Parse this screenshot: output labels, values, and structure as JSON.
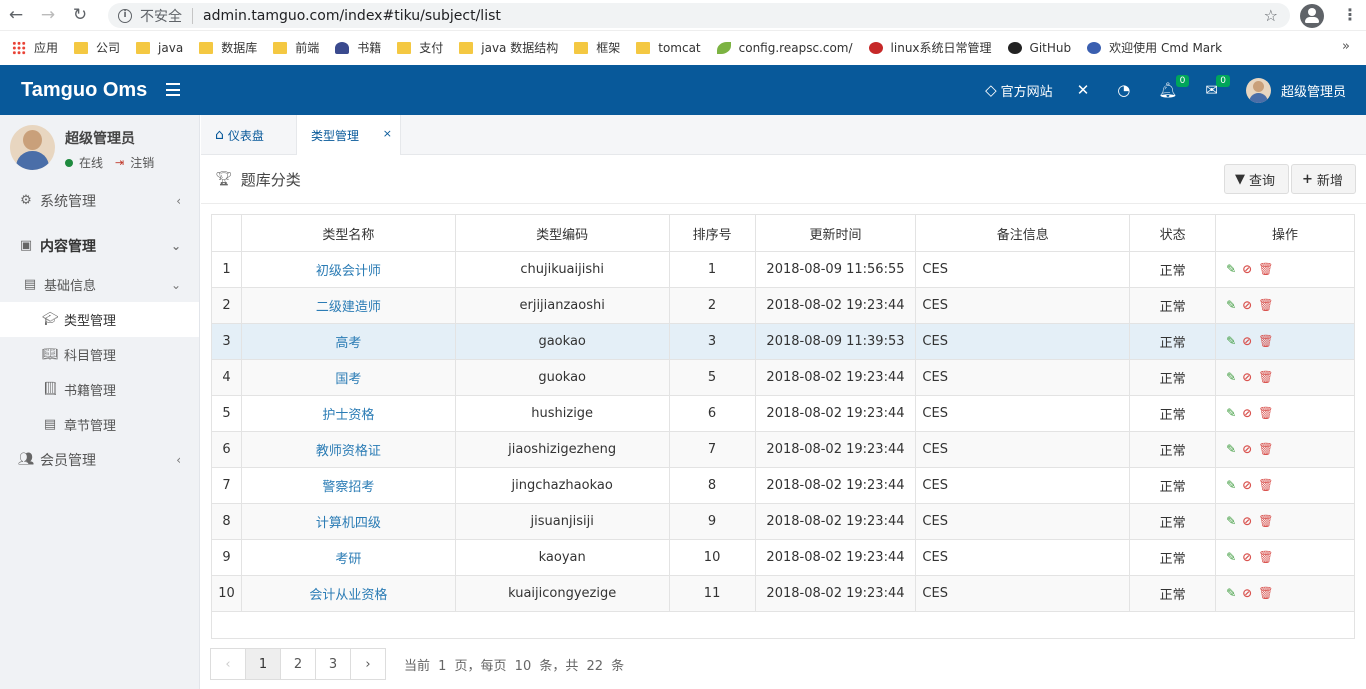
{
  "browser": {
    "insecure": "不安全",
    "url": "admin.tamguo.com/index#tiku/subject/list",
    "bookmarks": [
      "应用",
      "公司",
      "java",
      "数据库",
      "前端",
      "书籍",
      "支付",
      "java 数据结构",
      "框架",
      "tomcat",
      "config.reapsc.com/",
      "linux系统日常管理",
      "GitHub",
      "欢迎使用 Cmd Mark"
    ]
  },
  "header": {
    "brand": "Tamguo Oms",
    "official_site": "官方网站",
    "notify_count": "0",
    "mail_count": "0",
    "user": "超级管理员"
  },
  "sidebar": {
    "user_name": "超级管理员",
    "online": "在线",
    "logout": "注销",
    "items": {
      "system": "系统管理",
      "content": "内容管理",
      "basic": "基础信息",
      "type": "类型管理",
      "subject": "科目管理",
      "book": "书籍管理",
      "chapter": "章节管理",
      "member": "会员管理"
    }
  },
  "tabs": {
    "dashboard": "仪表盘",
    "type": "类型管理",
    "close": "×"
  },
  "box": {
    "title": "题库分类",
    "query": "查询",
    "add": "新增"
  },
  "table": {
    "headers": [
      "",
      "类型名称",
      "类型编码",
      "排序号",
      "更新时间",
      "备注信息",
      "状态",
      "操作"
    ],
    "rows": [
      {
        "idx": "1",
        "name": "初级会计师",
        "code": "chujikuaijishi",
        "sort": "1",
        "time": "2018-08-09 11:56:55",
        "remark": "CES",
        "status": "正常"
      },
      {
        "idx": "2",
        "name": "二级建造师",
        "code": "erjijianzaoshi",
        "sort": "2",
        "time": "2018-08-02 19:23:44",
        "remark": "CES",
        "status": "正常"
      },
      {
        "idx": "3",
        "name": "高考",
        "code": "gaokao",
        "sort": "3",
        "time": "2018-08-09 11:39:53",
        "remark": "CES",
        "status": "正常"
      },
      {
        "idx": "4",
        "name": "国考",
        "code": "guokao",
        "sort": "5",
        "time": "2018-08-02 19:23:44",
        "remark": "CES",
        "status": "正常"
      },
      {
        "idx": "5",
        "name": "护士资格",
        "code": "hushizige",
        "sort": "6",
        "time": "2018-08-02 19:23:44",
        "remark": "CES",
        "status": "正常"
      },
      {
        "idx": "6",
        "name": "教师资格证",
        "code": "jiaoshizigezheng",
        "sort": "7",
        "time": "2018-08-02 19:23:44",
        "remark": "CES",
        "status": "正常"
      },
      {
        "idx": "7",
        "name": "警察招考",
        "code": "jingchazhaokao",
        "sort": "8",
        "time": "2018-08-02 19:23:44",
        "remark": "CES",
        "status": "正常"
      },
      {
        "idx": "8",
        "name": "计算机四级",
        "code": "jisuanjisiji",
        "sort": "9",
        "time": "2018-08-02 19:23:44",
        "remark": "CES",
        "status": "正常"
      },
      {
        "idx": "9",
        "name": "考研",
        "code": "kaoyan",
        "sort": "10",
        "time": "2018-08-02 19:23:44",
        "remark": "CES",
        "status": "正常"
      },
      {
        "idx": "10",
        "name": "会计从业资格",
        "code": "kuaijicongyezige",
        "sort": "11",
        "time": "2018-08-02 19:23:44",
        "remark": "CES",
        "status": "正常"
      }
    ]
  },
  "pager": {
    "prev": "‹",
    "pages": [
      "1",
      "2",
      "3"
    ],
    "next": "›",
    "info": "当前 1 页，每页 10 条，共 22 条"
  },
  "colors": {
    "header_bg": "#08599a",
    "link": "#2b7cb5",
    "highlight_row": "#e4eff7"
  }
}
